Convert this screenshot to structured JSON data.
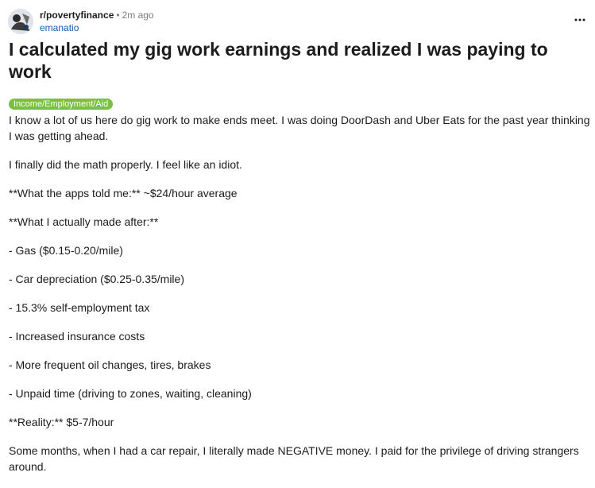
{
  "post": {
    "subreddit": "r/povertyfinance",
    "separator": "•",
    "time_ago": "2m ago",
    "username": "emanatio",
    "title": "I calculated my gig work earnings and realized I was paying to work",
    "flair": "Income/Employment/Aid",
    "flair_color": "#7ac142",
    "paragraphs": [
      "I know a lot of us here do gig work to make ends meet. I was doing DoorDash and Uber Eats for the past year thinking I was getting ahead.",
      "I finally did the math properly. I feel like an idiot.",
      "**What the apps told me:** ~$24/hour average",
      "**What I actually made after:**",
      "- Gas ($0.15-0.20/mile)",
      "- Car depreciation ($0.25-0.35/mile)",
      "- 15.3% self-employment tax",
      "- Increased insurance costs",
      "- More frequent oil changes, tires, brakes",
      "- Unpaid time (driving to zones, waiting, cleaning)",
      "**Reality:** $5-7/hour",
      "Some months, when I had a car repair, I literally made NEGATIVE money. I paid for the privilege of driving strangers around."
    ]
  },
  "icons": {
    "avatar": "avatar-icon",
    "more": "more-options-icon"
  }
}
